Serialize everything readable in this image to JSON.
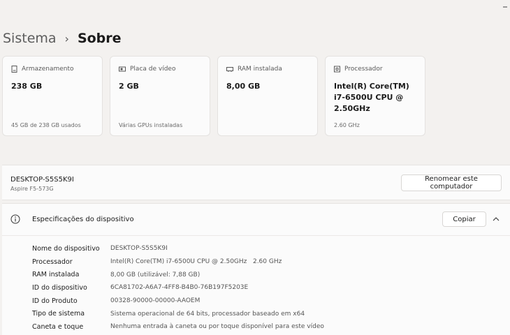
{
  "breadcrumb": {
    "parent": "Sistema",
    "separator": "›",
    "current": "Sobre"
  },
  "cards": [
    {
      "icon": "storage-icon",
      "label": "Armazenamento",
      "value": "238 GB",
      "sub": "45 GB de 238 GB usados"
    },
    {
      "icon": "gpu-icon",
      "label": "Placa de vídeo",
      "value": "2 GB",
      "sub": "Várias GPUs instaladas"
    },
    {
      "icon": "ram-icon",
      "label": "RAM instalada",
      "value": "8,00 GB",
      "sub": ""
    },
    {
      "icon": "processor-icon",
      "label": "Processador",
      "value": "Intel(R) Core(TM) i7-6500U CPU @ 2.50GHz",
      "sub": "2.60 GHz"
    }
  ],
  "device": {
    "name": "DESKTOP-S5S5K9I",
    "model": "Aspire F5-573G",
    "rename_label": "Renomear este computador"
  },
  "specs": {
    "title": "Especificações do dispositivo",
    "copy_label": "Copiar",
    "rows": [
      {
        "key": "Nome do dispositivo",
        "value": "DESKTOP-S5S5K9I"
      },
      {
        "key": "Processador",
        "value": "Intel(R) Core(TM) i7-6500U CPU @ 2.50GHz   2.60 GHz"
      },
      {
        "key": "RAM instalada",
        "value": "8,00 GB (utilizável: 7,88 GB)"
      },
      {
        "key": "ID do dispositivo",
        "value": "6CA81702-A6A7-4FF8-B4B0-76B197F5203E"
      },
      {
        "key": "ID do Produto",
        "value": "00328-90000-00000-AAOEM"
      },
      {
        "key": "Tipo de sistema",
        "value": "Sistema operacional de 64 bits, processador baseado em x64"
      },
      {
        "key": "Caneta e toque",
        "value": "Nenhuma entrada à caneta ou por toque disponível para este vídeo"
      }
    ]
  }
}
